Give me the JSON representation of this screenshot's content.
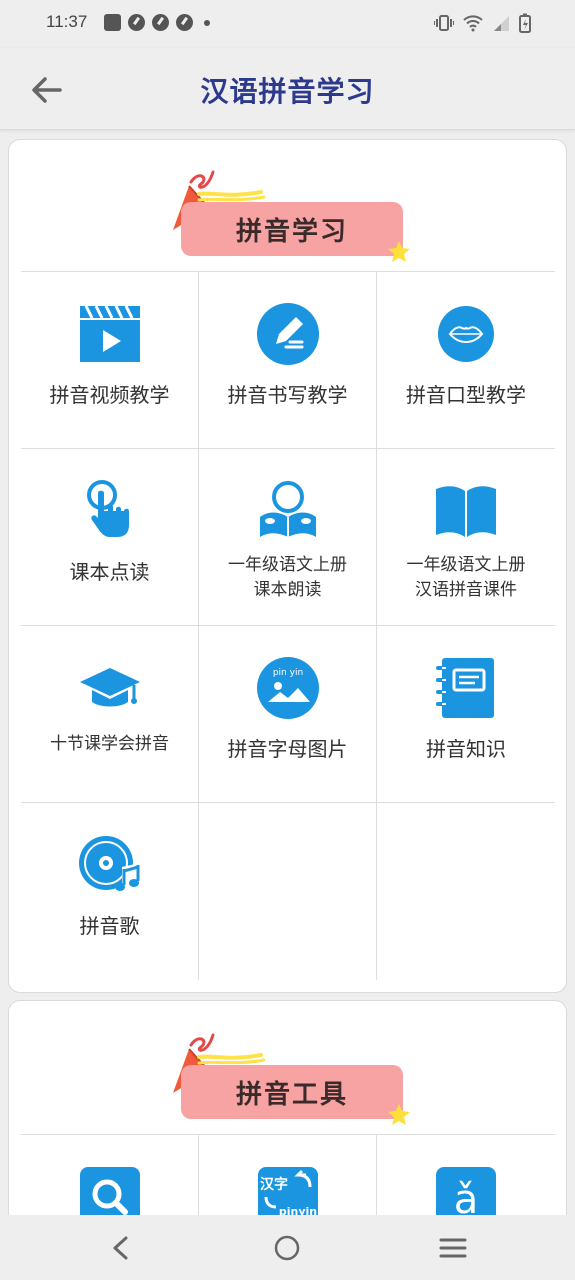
{
  "status_bar": {
    "time": "11:37",
    "icons_left": [
      "notification-box-icon",
      "speedometer-icon",
      "speedometer-icon",
      "speedometer-icon",
      "dot-icon"
    ],
    "icons_right": [
      "vibrate-icon",
      "wifi-icon",
      "signal-icon",
      "battery-charging-icon"
    ]
  },
  "app_bar": {
    "title": "汉语拼音学习",
    "title_color": "#2d3a8c",
    "back_icon": "arrow-left-icon"
  },
  "colors": {
    "accent_blue": "#1c95e0",
    "banner_pink": "#f7a3a3",
    "background": "#eeeeee"
  },
  "sections": [
    {
      "title": "拼音学习",
      "items": [
        {
          "label": "拼音视频教学",
          "icon": "video-clapper-icon"
        },
        {
          "label": "拼音书写教学",
          "icon": "pencil-writing-icon"
        },
        {
          "label": "拼音口型教学",
          "icon": "lips-icon"
        },
        {
          "label": "课本点读",
          "icon": "finger-tap-icon"
        },
        {
          "label": "一年级语文上册 课本朗读",
          "line1": "一年级语文上册",
          "line2": "课本朗读",
          "icon": "reading-person-icon"
        },
        {
          "label": "一年级语文上册 汉语拼音课件",
          "line1": "一年级语文上册",
          "line2": "汉语拼音课件",
          "icon": "open-book-icon"
        },
        {
          "label": "十节课学会拼音",
          "icon": "graduation-cap-icon"
        },
        {
          "label": "拼音字母图片",
          "icon": "pinyin-picture-icon",
          "icon_text": "pin yin"
        },
        {
          "label": "拼音知识",
          "icon": "notebook-icon"
        },
        {
          "label": "拼音歌",
          "icon": "music-disc-icon"
        }
      ]
    },
    {
      "title": "拼音工具",
      "items": [
        {
          "icon": "search-icon"
        },
        {
          "icon": "hanzi-pinyin-convert-icon",
          "icon_text_top": "汉字",
          "icon_text_bottom": "pinyin"
        },
        {
          "icon": "tone-letter-icon",
          "icon_text": "ǎ"
        }
      ]
    }
  ],
  "nav_bar": {
    "buttons": [
      "back-triangle-icon",
      "home-circle-icon",
      "recent-apps-icon"
    ]
  }
}
